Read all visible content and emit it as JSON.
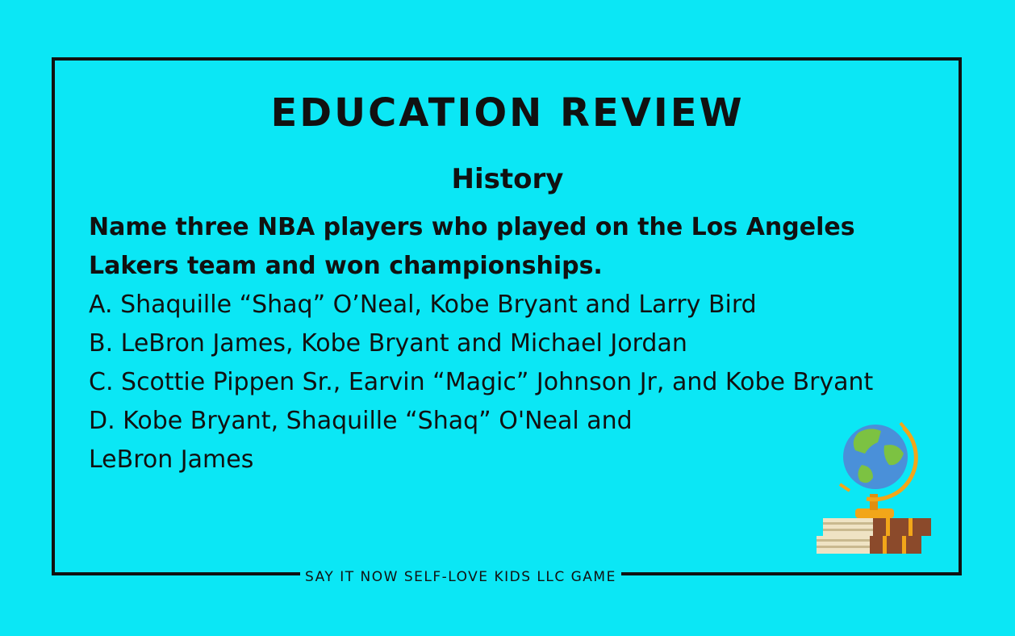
{
  "card": {
    "title": "EDUCATION REVIEW",
    "subject": "History",
    "question": "Name three NBA players who played on the Los Angeles Lakers team and won championships.",
    "options": [
      "A. Shaquille “Shaq” O’Neal, Kobe Bryant and Larry Bird",
      "B. LeBron James, Kobe Bryant and Michael Jordan",
      "C. Scottie Pippen Sr., Earvin “Magic” Johnson Jr, and Kobe Bryant",
      "D. Kobe Bryant, Shaquille “Shaq” O'Neal and LeBron James"
    ],
    "footer": "SAY IT NOW SELF-LOVE KIDS LLC GAME"
  },
  "illustration": {
    "icon": "globe-on-books-icon"
  },
  "colors": {
    "background": "#0be7f5",
    "text": "#111111",
    "globe_ocean": "#4a90d9",
    "globe_land": "#7cc242",
    "stand": "#f2a619",
    "book": "#8b4a2b",
    "pages": "#efe3c4"
  }
}
